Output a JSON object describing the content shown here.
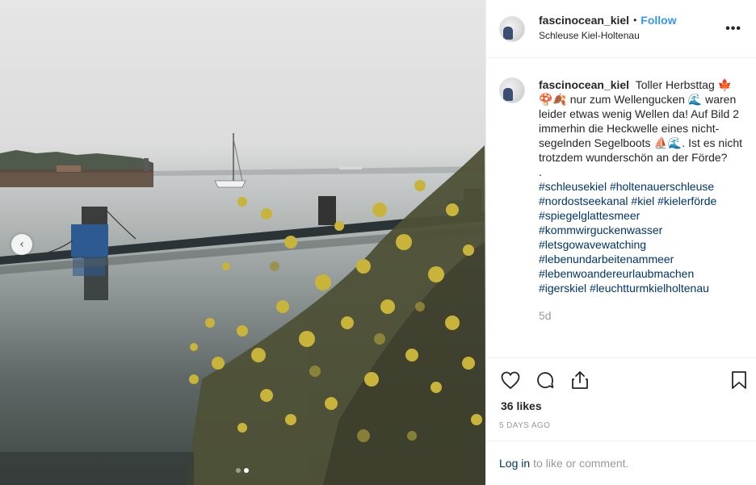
{
  "post": {
    "username": "fascinocean_kiel",
    "separator": "•",
    "follow_label": "Follow",
    "location": "Schleuse Kiel-Holtenau",
    "more_label": "•••"
  },
  "caption": {
    "username": "fascinocean_kiel",
    "text": "Toller Herbsttag 🍁🍄🍂 nur zum Wellengucken 🌊 waren leider etwas wenig Wellen da! Auf Bild 2 immerhin die Heckwelle eines nicht-segelnden Segelboots ⛵🌊. Ist es nicht trotzdem wunderschön an der Förde?",
    "dot_line": ".",
    "hashtags": [
      "#schleusekiel",
      "#holtenauerschleuse",
      "#nordostseekanal",
      "#kiel",
      "#kielerförde",
      "#spiegelglattesmeer",
      "#kommwirguckenwasser",
      "#letsgowavewatching",
      "#lebenundarbeitenammeer",
      "#lebenwoandereurlaubmachen",
      "#igerskiel",
      "#leuchtturmkielholtenau"
    ],
    "age": "5d"
  },
  "actions": {
    "like_icon": "heart-icon",
    "comment_icon": "comment-icon",
    "share_icon": "share-icon",
    "save_icon": "bookmark-icon"
  },
  "likes": "36 likes",
  "date": "5 DAYS AGO",
  "login": {
    "link_label": "Log in",
    "rest_text": "to like or comment."
  },
  "carousel": {
    "prev_icon": "chevron-left-icon",
    "prev_glyph": "‹",
    "current_index": 2,
    "total": 2
  }
}
